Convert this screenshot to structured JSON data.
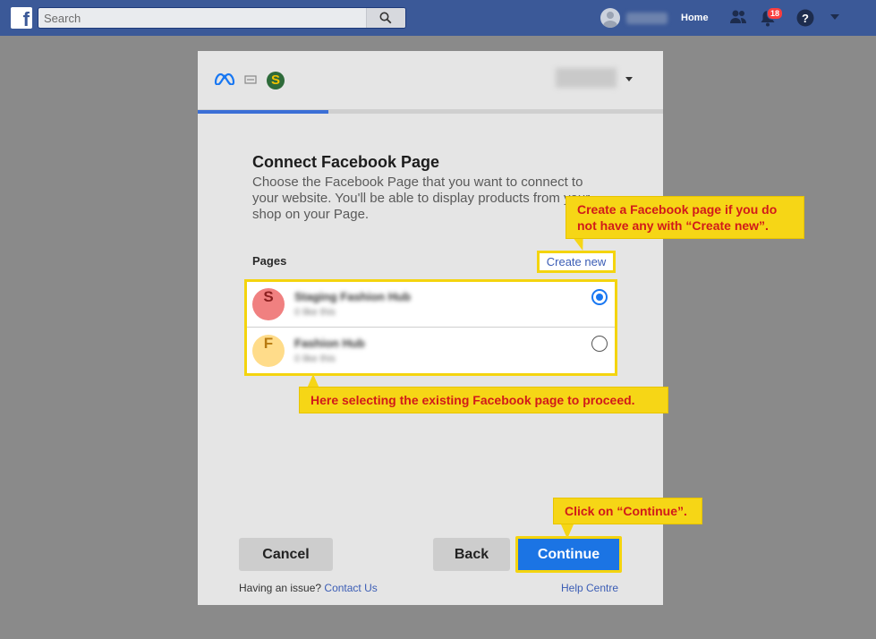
{
  "topbar": {
    "search_placeholder": "Search",
    "home_label": "Home",
    "notification_count": "18"
  },
  "dialog": {
    "progress_percent": 28,
    "title": "Connect Facebook Page",
    "description": "Choose the Facebook Page that you want to connect to your website. You'll be able to display products from your shop on your Page.",
    "pages_label": "Pages",
    "create_new_label": "Create new",
    "pages": [
      {
        "initial": "S",
        "name": "Staging Fashion Hub",
        "subtitle": "0 like this",
        "selected": true,
        "color": "#f08080",
        "text_color": "#8a1f1f"
      },
      {
        "initial": "F",
        "name": "Fashion Hub",
        "subtitle": "0 like this",
        "selected": false,
        "color": "#ffdc8a",
        "text_color": "#b87a10"
      }
    ],
    "buttons": {
      "cancel": "Cancel",
      "back": "Back",
      "continue": "Continue"
    },
    "footer": {
      "issue_text": "Having an issue?",
      "contact_link": "Contact Us",
      "help_link": "Help Centre"
    }
  },
  "annotations": {
    "create_new_note": "Create a Facebook page if you do not have any with “Create new”.",
    "select_page_note": "Here selecting the existing Facebook page to proceed.",
    "continue_note": "Click on “Continue”."
  },
  "colors": {
    "facebook_blue": "#3b5998",
    "primary_button": "#1b74e4",
    "highlight": "#f4d40e",
    "callout_text": "#d11a1a"
  }
}
